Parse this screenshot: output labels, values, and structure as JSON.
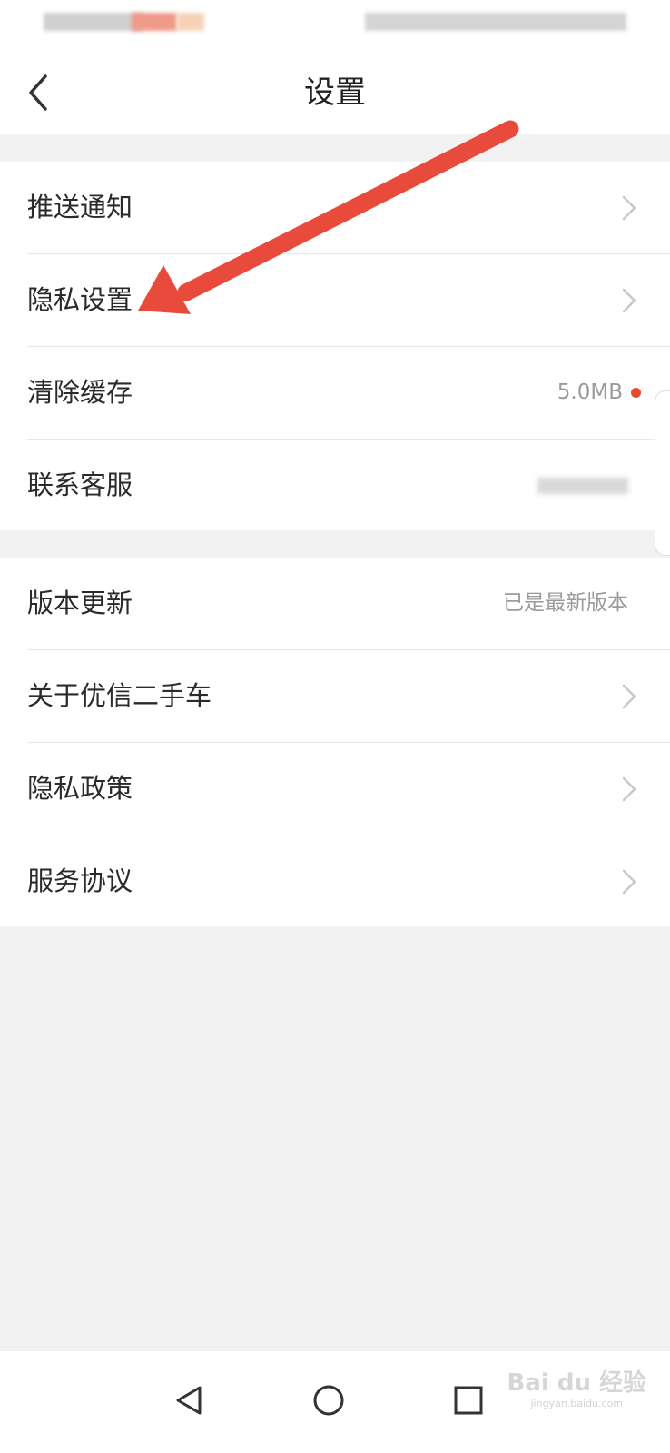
{
  "header": {
    "title": "设置"
  },
  "group1": [
    {
      "label": "推送通知"
    },
    {
      "label": "隐私设置"
    },
    {
      "label": "清除缓存",
      "value": "5.0MB"
    },
    {
      "label": "联系客服"
    }
  ],
  "group2": [
    {
      "label": "版本更新",
      "value": "已是最新版本"
    },
    {
      "label": "关于优信二手车"
    },
    {
      "label": "隐私政策"
    },
    {
      "label": "服务协议"
    }
  ],
  "watermark": {
    "brand": "Bai du 经验",
    "url": "jingyan.baidu.com"
  },
  "colors": {
    "accent": "#e84a2a",
    "arrow": "#e84a3c",
    "background": "#f2f2f2"
  },
  "icons": {
    "back": "chevron-left-icon",
    "row": "chevron-right-icon",
    "nav_back": "triangle-back-icon",
    "nav_home": "circle-home-icon",
    "nav_recent": "square-recent-icon"
  }
}
